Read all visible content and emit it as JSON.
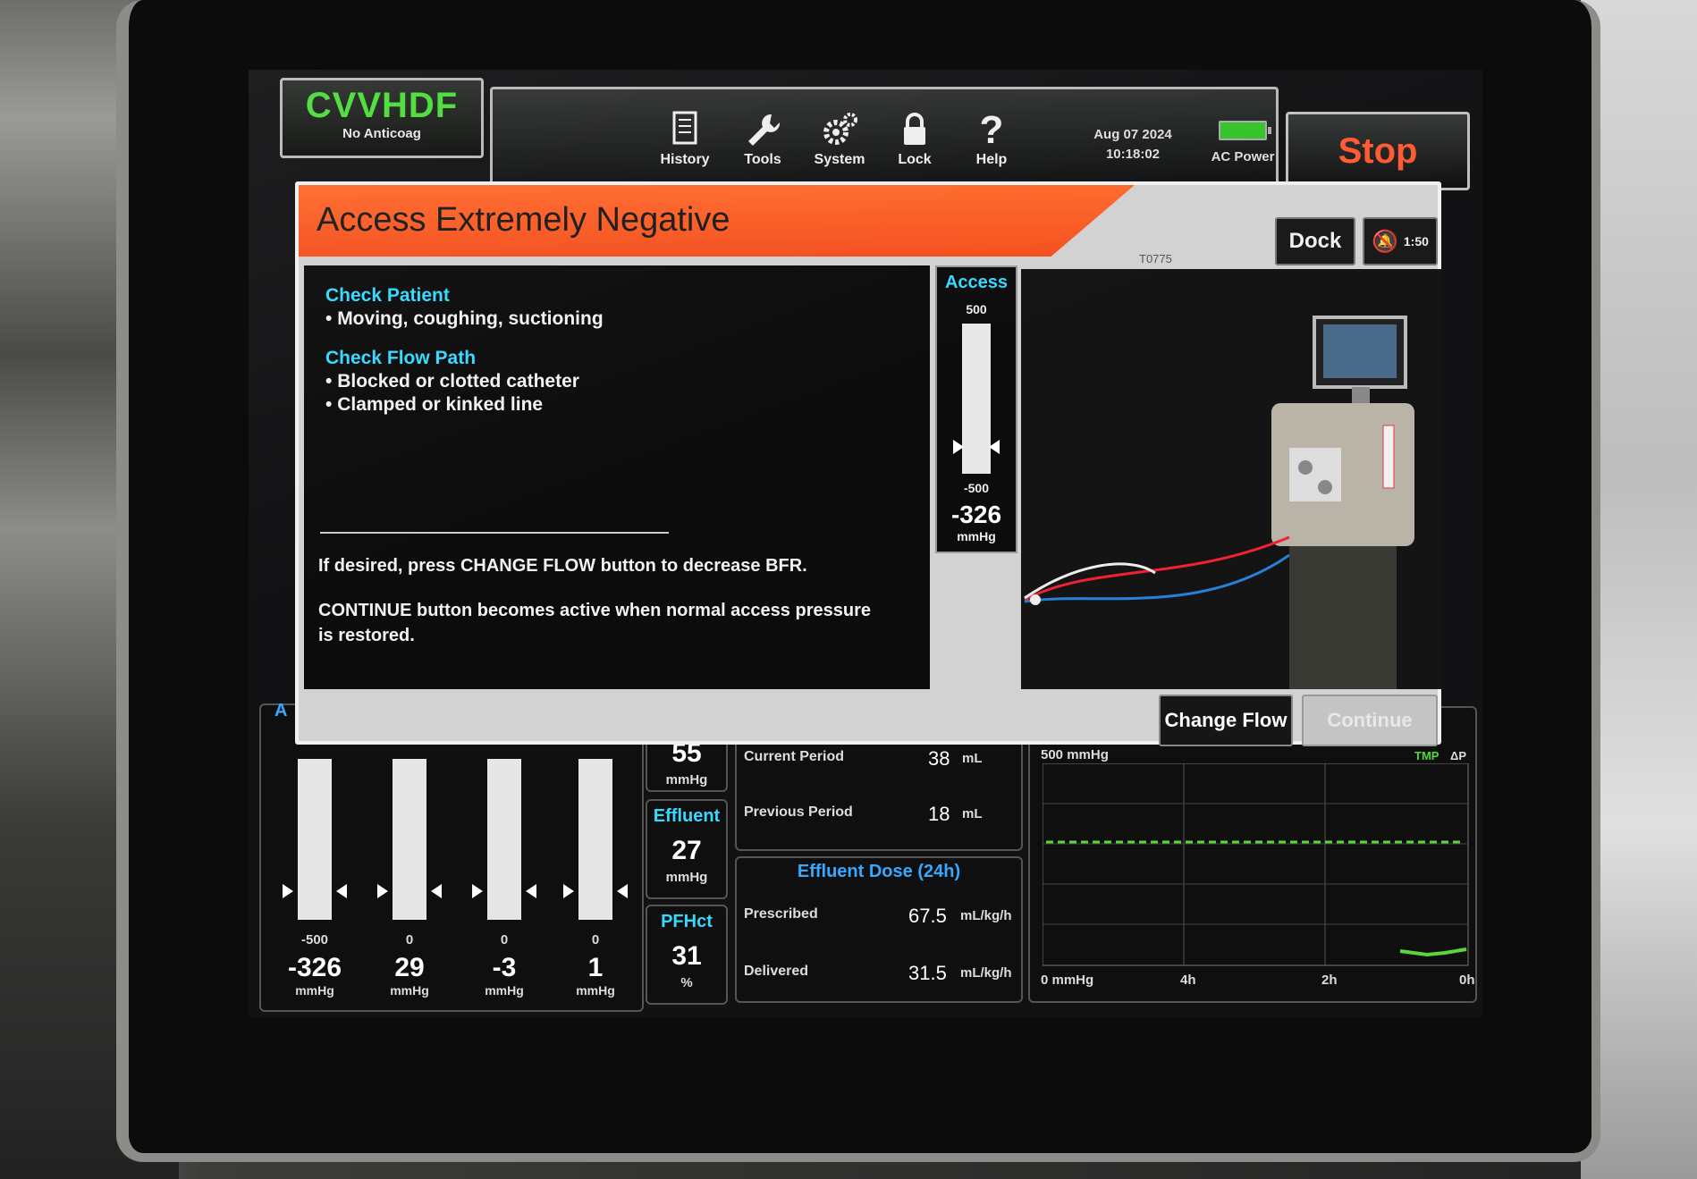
{
  "mode": {
    "name": "CVVHDF",
    "anticoag": "No Anticoag"
  },
  "toolbar": {
    "items": [
      {
        "label": "History",
        "icon": "history-icon"
      },
      {
        "label": "Tools",
        "icon": "wrench-icon"
      },
      {
        "label": "System",
        "icon": "gears-icon"
      },
      {
        "label": "Lock",
        "icon": "lock-icon"
      },
      {
        "label": "Help",
        "icon": "question-icon"
      }
    ],
    "date": "Aug 07 2024",
    "time": "10:18:02",
    "power_label": "AC Power",
    "stop_label": "Stop"
  },
  "alarm": {
    "title": "Access Extremely Negative",
    "code": "T0775",
    "dock_label": "Dock",
    "mute_label": "1:50",
    "sections": [
      {
        "heading": "Check Patient",
        "bullets": [
          "Moving, coughing, suctioning"
        ]
      },
      {
        "heading": "Check Flow Path",
        "bullets": [
          "Blocked or clotted catheter",
          "Clamped or kinked line"
        ]
      }
    ],
    "note1": "If desired, press CHANGE FLOW button to decrease BFR.",
    "note2": "CONTINUE button becomes active when normal access pressure is restored.",
    "gauge": {
      "title": "Access",
      "max": "500",
      "min": "-500",
      "value": "-326",
      "unit": "mmHg"
    },
    "change_flow_label": "Change Flow",
    "continue_label": "Continue"
  },
  "pressures": {
    "tab_label": "A",
    "columns": [
      {
        "limit": "-500",
        "value": "-326",
        "unit": "mmHg"
      },
      {
        "limit": "0",
        "value": "29",
        "unit": "mmHg"
      },
      {
        "limit": "0",
        "value": "-3",
        "unit": "mmHg"
      },
      {
        "limit": "0",
        "value": "1",
        "unit": "mmHg"
      }
    ]
  },
  "mini_panels": [
    {
      "title": "",
      "value": "55",
      "unit": "mmHg"
    },
    {
      "title": "Effluent",
      "value": "27",
      "unit": "mmHg"
    },
    {
      "title": "PFHct",
      "value": "31",
      "unit": "%"
    }
  ],
  "fluid_removal": {
    "rows": [
      {
        "label": "Current Period",
        "value": "38",
        "unit": "mL"
      },
      {
        "label": "Previous Period",
        "value": "18",
        "unit": "mL"
      }
    ]
  },
  "effluent_dose": {
    "title": "Effluent Dose (24h)",
    "rows": [
      {
        "label": "Prescribed",
        "value": "67.5",
        "unit": "mL/kg/h"
      },
      {
        "label": "Delivered",
        "value": "31.5",
        "unit": "mL/kg/h"
      }
    ]
  },
  "trend": {
    "top_label": "500 mmHg",
    "bottom_label": "0 mmHg",
    "legend": [
      "TMP",
      "ΔP"
    ],
    "x_labels": [
      "4h",
      "2h",
      "0h"
    ]
  },
  "colors": {
    "accent": "#36d8ff",
    "alarm": "#f4501e",
    "stop": "#ff5a34",
    "mode": "#4bdc3a"
  }
}
